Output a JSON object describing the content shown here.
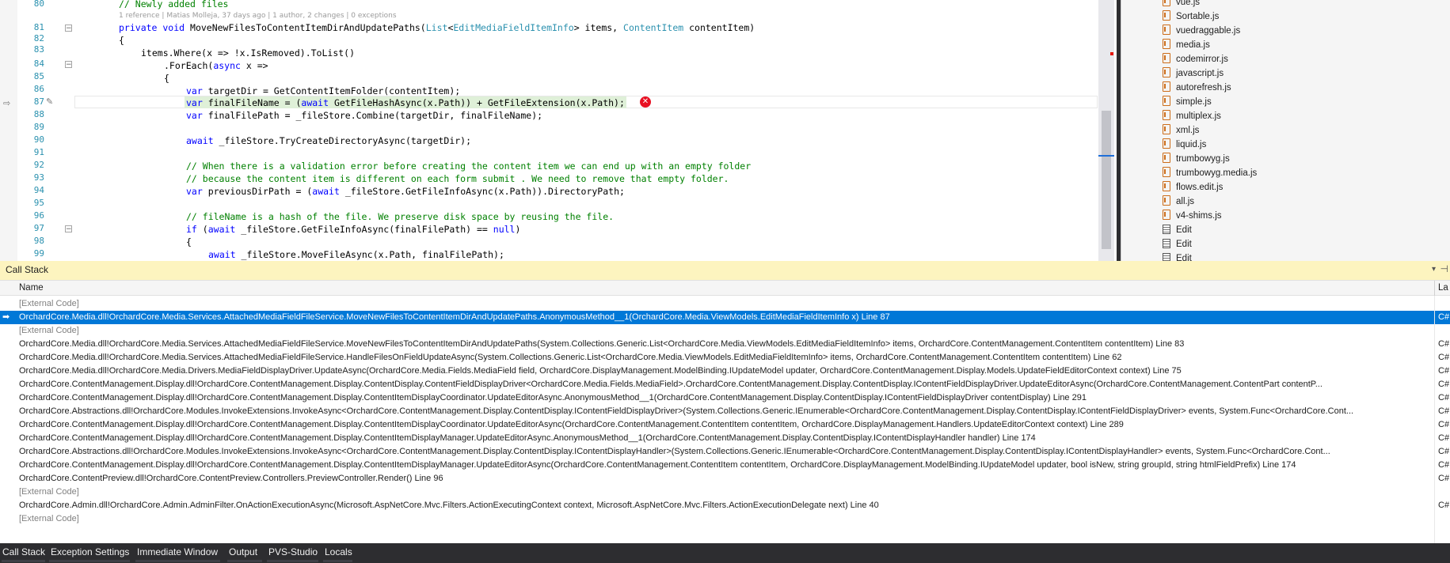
{
  "editor": {
    "lens_text": "1 reference | Matias Molleja, 37 days ago | 1 author, 2 changes | 0 exceptions",
    "line_numbers": [
      "80",
      "81",
      "82",
      "83",
      "84",
      "85",
      "86",
      "87",
      "88",
      "89",
      "90",
      "91",
      "92",
      "93",
      "94",
      "95",
      "96",
      "97",
      "98",
      "99"
    ],
    "lines": {
      "l80": "// Newly added files",
      "l81_kw": "private void",
      "l81_a": " MoveNewFilesToContentItemDirAndUpdatePaths(",
      "l81_t1": "List",
      "l81_b": "<",
      "l81_t2": "EditMediaFieldItemInfo",
      "l81_c": "> items, ",
      "l81_t3": "ContentItem",
      "l81_d": " contentItem)",
      "l82": "{",
      "l83": "items.Where(x => !x.IsRemoved).ToList()",
      "l84_a": ".ForEach(",
      "l84_kw": "async",
      "l84_b": " x =>",
      "l85": "{",
      "l86_kw": "var",
      "l86": " targetDir = GetContentItemFolder(contentItem);",
      "l87_kw": "var",
      "l87_a": " finalFileName = (",
      "l87_kw2": "await",
      "l87_b": " GetFileHashAsync(x.Path)) + GetFileExtension(x.Path);",
      "l88_kw": "var",
      "l88": " finalFilePath = _fileStore.Combine(targetDir, finalFileName);",
      "l90_kw": "await",
      "l90": " _fileStore.TryCreateDirectoryAsync(targetDir);",
      "l92": "// When there is a validation error before creating the content item we can end up with an empty folder",
      "l93": "// because the content item is different on each form submit . We need to remove that empty folder.",
      "l94_kw": "var",
      "l94_a": " previousDirPath = (",
      "l94_kw2": "await",
      "l94_b": " _fileStore.GetFileInfoAsync(x.Path)).DirectoryPath;",
      "l96": "// fileName is a hash of the file. We preserve disk space by reusing the file.",
      "l97_kw": "if",
      "l97_a": " (",
      "l97_kw2": "await",
      "l97_b": " _fileStore.GetFileInfoAsync(finalFilePath) == ",
      "l97_kw3": "null",
      "l97_c": ")",
      "l98": "{",
      "l99_kw": "await",
      "l99": " _fileStore.MoveFileAsync(x.Path, finalFilePath);"
    },
    "error_glyph": "✕"
  },
  "solution_files": [
    {
      "name": "vue.js",
      "icon": "js-icon"
    },
    {
      "name": "Sortable.js",
      "icon": "js-icon"
    },
    {
      "name": "vuedraggable.js",
      "icon": "js-icon"
    },
    {
      "name": "media.js",
      "icon": "js-icon"
    },
    {
      "name": "codemirror.js",
      "icon": "js-icon"
    },
    {
      "name": "javascript.js",
      "icon": "js-icon"
    },
    {
      "name": "autorefresh.js",
      "icon": "js-icon"
    },
    {
      "name": "simple.js",
      "icon": "js-icon"
    },
    {
      "name": "multiplex.js",
      "icon": "js-icon"
    },
    {
      "name": "xml.js",
      "icon": "js-icon"
    },
    {
      "name": "liquid.js",
      "icon": "js-icon"
    },
    {
      "name": "trumbowyg.js",
      "icon": "js-icon"
    },
    {
      "name": "trumbowyg.media.js",
      "icon": "js-icon"
    },
    {
      "name": "flows.edit.js",
      "icon": "js-icon"
    },
    {
      "name": "all.js",
      "icon": "js-icon"
    },
    {
      "name": "v4-shims.js",
      "icon": "js-icon"
    },
    {
      "name": "Edit",
      "icon": "doc-icon"
    },
    {
      "name": "Edit",
      "icon": "doc-icon"
    },
    {
      "name": "Edit",
      "icon": "doc-icon"
    }
  ],
  "call_stack": {
    "title": "Call Stack",
    "dropdown_glyph": "▾",
    "pin_glyph": "⊣",
    "columns": {
      "name": "Name",
      "lang": "La"
    },
    "rows": [
      {
        "name": "[External Code]",
        "lang": "",
        "external": true
      },
      {
        "name": "OrchardCore.Media.dll!OrchardCore.Media.Services.AttachedMediaFieldFileService.MoveNewFilesToContentItemDirAndUpdatePaths.AnonymousMethod__1(OrchardCore.Media.ViewModels.EditMediaFieldItemInfo x) Line 87",
        "lang": "C#",
        "selected": true
      },
      {
        "name": "[External Code]",
        "lang": "",
        "external": true
      },
      {
        "name": "OrchardCore.Media.dll!OrchardCore.Media.Services.AttachedMediaFieldFileService.MoveNewFilesToContentItemDirAndUpdatePaths(System.Collections.Generic.List<OrchardCore.Media.ViewModels.EditMediaFieldItemInfo> items, OrchardCore.ContentManagement.ContentItem contentItem) Line 83",
        "lang": "C#"
      },
      {
        "name": "OrchardCore.Media.dll!OrchardCore.Media.Services.AttachedMediaFieldFileService.HandleFilesOnFieldUpdateAsync(System.Collections.Generic.List<OrchardCore.Media.ViewModels.EditMediaFieldItemInfo> items, OrchardCore.ContentManagement.ContentItem contentItem) Line 62",
        "lang": "C#"
      },
      {
        "name": "OrchardCore.Media.dll!OrchardCore.Media.Drivers.MediaFieldDisplayDriver.UpdateAsync(OrchardCore.Media.Fields.MediaField field, OrchardCore.DisplayManagement.ModelBinding.IUpdateModel updater, OrchardCore.ContentManagement.Display.Models.UpdateFieldEditorContext context) Line 75",
        "lang": "C#"
      },
      {
        "name": "OrchardCore.ContentManagement.Display.dll!OrchardCore.ContentManagement.Display.ContentDisplay.ContentFieldDisplayDriver<OrchardCore.Media.Fields.MediaField>.OrchardCore.ContentManagement.Display.ContentDisplay.IContentFieldDisplayDriver.UpdateEditorAsync(OrchardCore.ContentManagement.ContentPart contentP...",
        "lang": "C#"
      },
      {
        "name": "OrchardCore.ContentManagement.Display.dll!OrchardCore.ContentManagement.Display.ContentItemDisplayCoordinator.UpdateEditorAsync.AnonymousMethod__1(OrchardCore.ContentManagement.Display.ContentDisplay.IContentFieldDisplayDriver contentDisplay) Line 291",
        "lang": "C#"
      },
      {
        "name": "OrchardCore.Abstractions.dll!OrchardCore.Modules.InvokeExtensions.InvokeAsync<OrchardCore.ContentManagement.Display.ContentDisplay.IContentFieldDisplayDriver>(System.Collections.Generic.IEnumerable<OrchardCore.ContentManagement.Display.ContentDisplay.IContentFieldDisplayDriver> events, System.Func<OrchardCore.Cont...",
        "lang": "C#"
      },
      {
        "name": "OrchardCore.ContentManagement.Display.dll!OrchardCore.ContentManagement.Display.ContentItemDisplayCoordinator.UpdateEditorAsync(OrchardCore.ContentManagement.ContentItem contentItem, OrchardCore.DisplayManagement.Handlers.UpdateEditorContext context) Line 289",
        "lang": "C#"
      },
      {
        "name": "OrchardCore.ContentManagement.Display.dll!OrchardCore.ContentManagement.Display.ContentItemDisplayManager.UpdateEditorAsync.AnonymousMethod__1(OrchardCore.ContentManagement.Display.ContentDisplay.IContentDisplayHandler handler) Line 174",
        "lang": "C#"
      },
      {
        "name": "OrchardCore.Abstractions.dll!OrchardCore.Modules.InvokeExtensions.InvokeAsync<OrchardCore.ContentManagement.Display.ContentDisplay.IContentDisplayHandler>(System.Collections.Generic.IEnumerable<OrchardCore.ContentManagement.Display.ContentDisplay.IContentDisplayHandler> events, System.Func<OrchardCore.Cont...",
        "lang": "C#"
      },
      {
        "name": "OrchardCore.ContentManagement.Display.dll!OrchardCore.ContentManagement.Display.ContentItemDisplayManager.UpdateEditorAsync(OrchardCore.ContentManagement.ContentItem contentItem, OrchardCore.DisplayManagement.ModelBinding.IUpdateModel updater, bool isNew, string groupId, string htmlFieldPrefix) Line 174",
        "lang": "C#"
      },
      {
        "name": "OrchardCore.ContentPreview.dll!OrchardCore.ContentPreview.Controllers.PreviewController.Render() Line 96",
        "lang": "C#"
      },
      {
        "name": "[External Code]",
        "lang": "",
        "external": true
      },
      {
        "name": "OrchardCore.Admin.dll!OrchardCore.Admin.AdminFilter.OnActionExecutionAsync(Microsoft.AspNetCore.Mvc.Filters.ActionExecutingContext context, Microsoft.AspNetCore.Mvc.Filters.ActionExecutionDelegate next) Line 40",
        "lang": "C#"
      },
      {
        "name": "[External Code]",
        "lang": "",
        "external": true
      }
    ]
  },
  "bottom_tabs": [
    "Call Stack",
    "Exception Settings",
    "Immediate Window",
    "Output",
    "PVS-Studio",
    "Locals"
  ],
  "colors": {
    "accent": "#0078d7",
    "keyword": "#0000ff",
    "type": "#2b91af",
    "comment": "#008000",
    "tool_title": "#fdf4bf",
    "error": "#e81123"
  }
}
